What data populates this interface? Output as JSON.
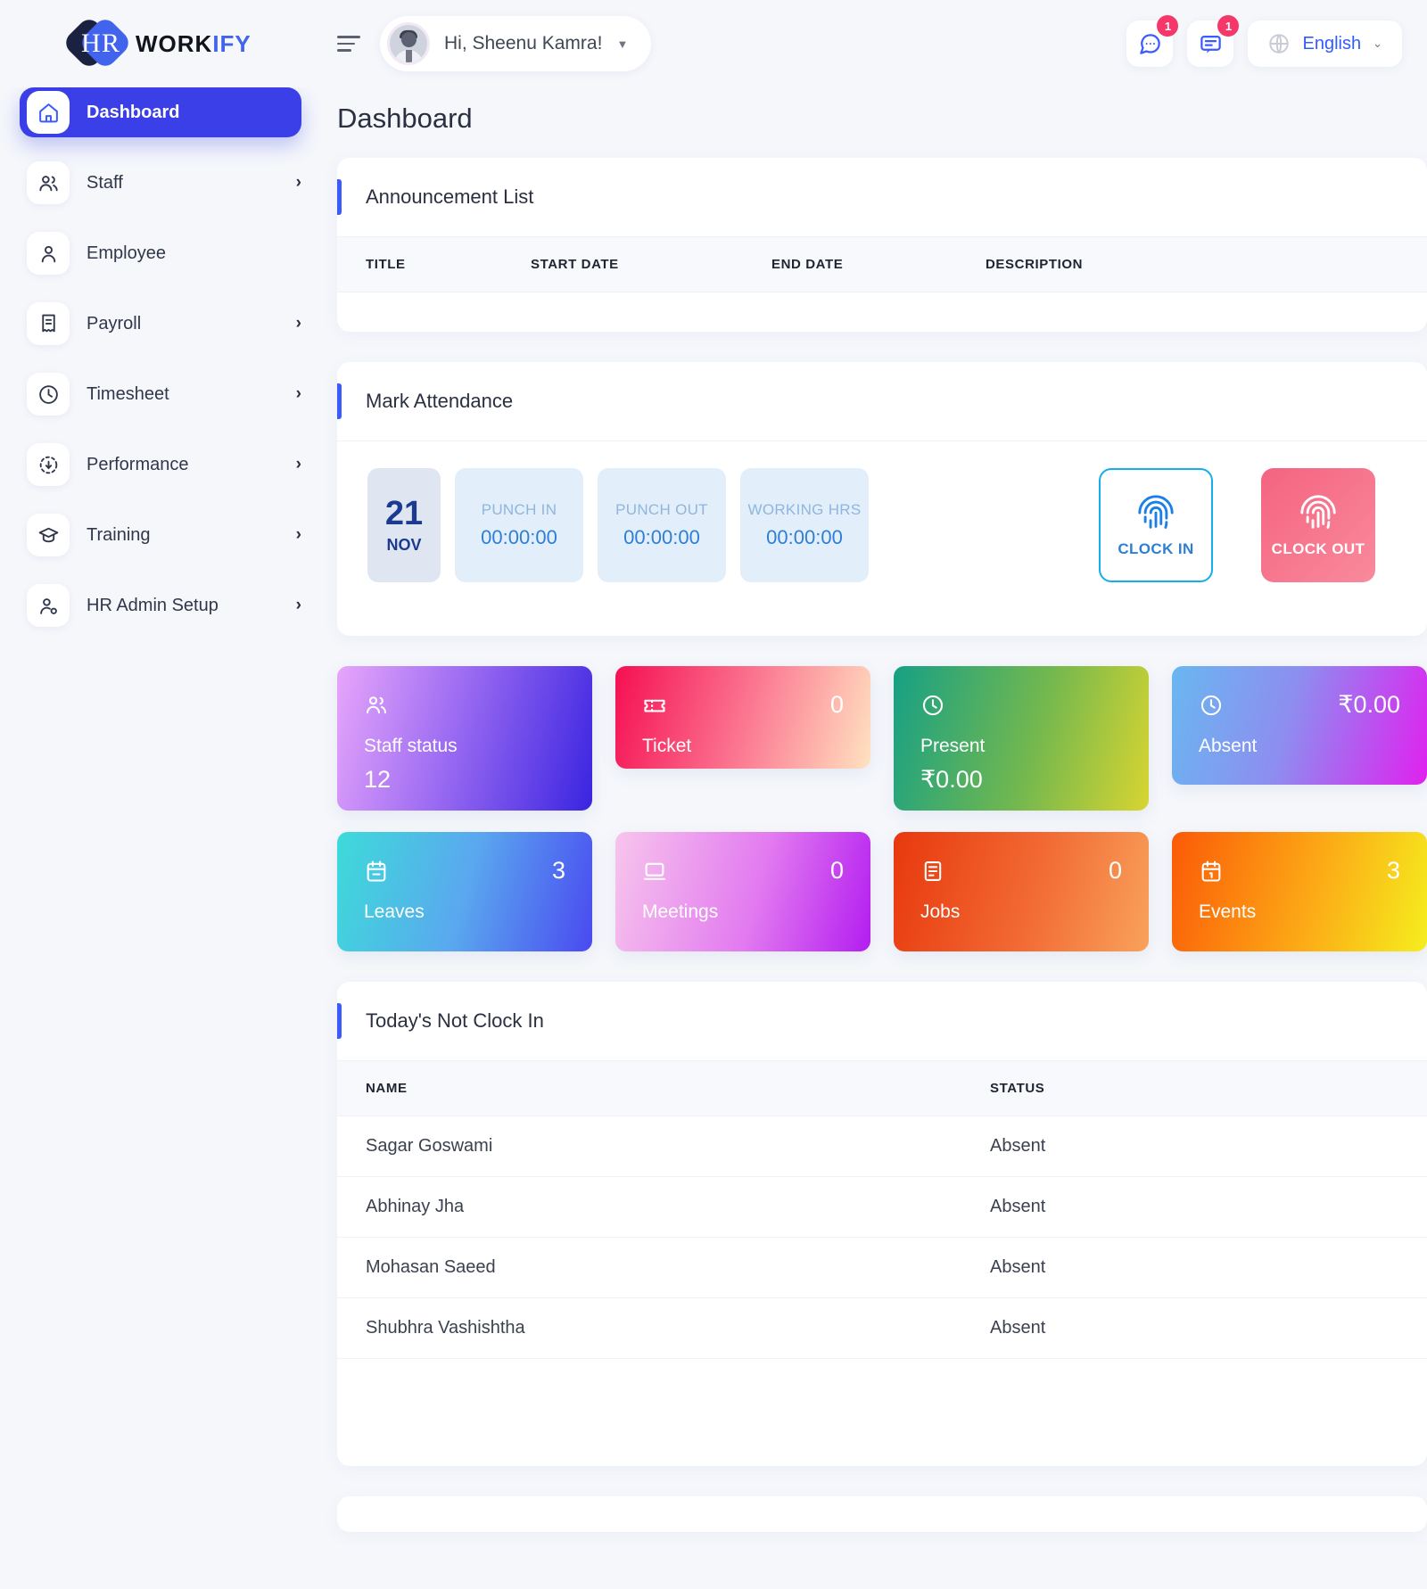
{
  "brand": {
    "name_part1": "WORK",
    "name_part2": "IFY",
    "mark_letter1": "H",
    "mark_letter2": "R"
  },
  "topbar": {
    "greeting": "Hi, Sheenu Kamra!",
    "chat_badge": "1",
    "message_badge": "1",
    "language": "English"
  },
  "sidebar": {
    "items": [
      {
        "label": "Dashboard",
        "icon": "home-icon",
        "caret": "",
        "active": true
      },
      {
        "label": "Staff",
        "icon": "users-icon",
        "caret": "›",
        "active": false
      },
      {
        "label": "Employee",
        "icon": "user-icon",
        "caret": "",
        "active": false
      },
      {
        "label": "Payroll",
        "icon": "receipt-icon",
        "caret": "›",
        "active": false
      },
      {
        "label": "Timesheet",
        "icon": "clock-icon",
        "caret": "›",
        "active": false
      },
      {
        "label": "Performance",
        "icon": "performance-icon",
        "caret": "›",
        "active": false
      },
      {
        "label": "Training",
        "icon": "graduation-icon",
        "caret": "›",
        "active": false
      },
      {
        "label": "HR Admin Setup",
        "icon": "user-gear-icon",
        "caret": "›",
        "active": false
      }
    ]
  },
  "main": {
    "page_title": "Dashboard",
    "announcement": {
      "title": "Announcement List",
      "columns": [
        "TITLE",
        "START DATE",
        "END DATE",
        "DESCRIPTION"
      ],
      "rows": []
    },
    "attendance": {
      "title": "Mark Attendance",
      "date_day": "21",
      "date_month": "NOV",
      "metrics": [
        {
          "label": "PUNCH IN",
          "value": "00:00:00"
        },
        {
          "label": "PUNCH OUT",
          "value": "00:00:00"
        },
        {
          "label": "WORKING HRS",
          "value": "00:00:00"
        }
      ],
      "clock_in_label": "CLOCK IN",
      "clock_out_label": "CLOCK OUT"
    },
    "tiles_row1": [
      {
        "name": "Staff status",
        "value": "12",
        "icon": "users-icon",
        "value_pos": "bottom",
        "accent": "#3a24e0"
      },
      {
        "name": "Ticket",
        "value": "0",
        "icon": "ticket-icon",
        "value_pos": "right",
        "accent": "#f50f52"
      },
      {
        "name": "Present",
        "value": "₹0.00",
        "icon": "clock-icon",
        "value_pos": "bottom",
        "accent": "#16a085"
      },
      {
        "name": "Absent",
        "value": "₹0.00",
        "icon": "clock-icon",
        "value_pos": "right",
        "accent": "#e021ef"
      }
    ],
    "tiles_row2": [
      {
        "name": "Leaves",
        "value": "3",
        "icon": "calendar-icon",
        "value_pos": "right",
        "accent": "#4a49f0"
      },
      {
        "name": "Meetings",
        "value": "0",
        "icon": "monitor-icon",
        "value_pos": "right",
        "accent": "#b31df0"
      },
      {
        "name": "Jobs",
        "value": "0",
        "icon": "briefcase-icon",
        "value_pos": "right",
        "accent": "#e8380d"
      },
      {
        "name": "Events",
        "value": "3",
        "icon": "calendar-icon",
        "value_pos": "right",
        "accent": "#fb5a07"
      }
    ],
    "not_clock_in": {
      "title": "Today's Not Clock In",
      "columns": [
        "NAME",
        "STATUS"
      ],
      "rows": [
        {
          "name": "Sagar Goswami",
          "status": "Absent"
        },
        {
          "name": "Abhinay Jha",
          "status": "Absent"
        },
        {
          "name": "Mohasan Saeed",
          "status": "Absent"
        },
        {
          "name": "Shubhra Vashishtha",
          "status": "Absent"
        }
      ]
    }
  }
}
